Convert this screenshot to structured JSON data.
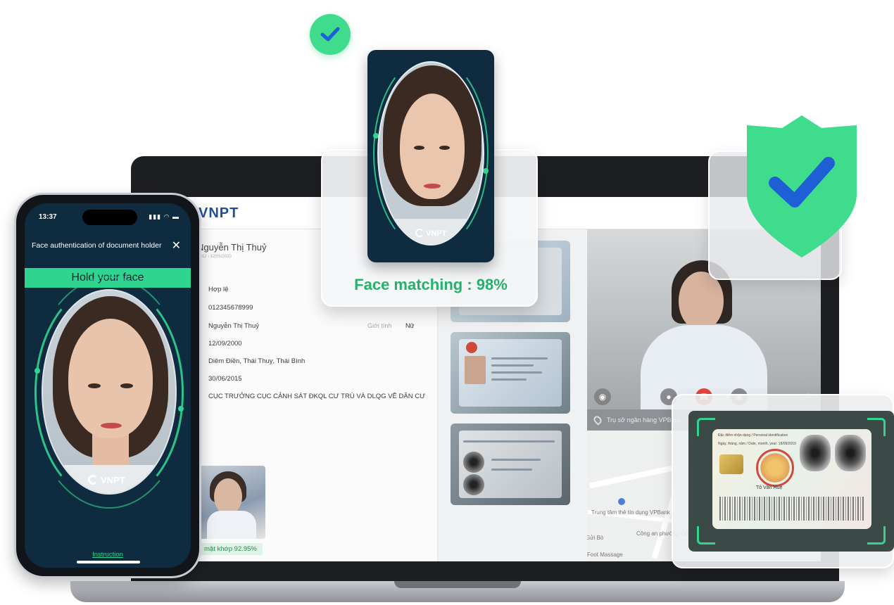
{
  "laptop": {
    "logo": "VNPT",
    "record": {
      "holder_name": "Nguyễn Thị Thuỷ",
      "holder_sub": "2012 - 12/05/2020",
      "rows": [
        "Hợp lệ",
        "012345678999",
        "Nguyễn Thị Thuỷ",
        "12/09/2000",
        "Diêm Điền, Thái Thuỵ, Thái Bình",
        "30/06/2015",
        "CỤC TRƯỞNG CỤC CẢNH SÁT ĐKQL CƯ TRÚ VÀ DLQG VỀ DÂN CƯ"
      ],
      "gender_label": "Giới tính",
      "gender_value": "Nữ",
      "match_pill": "mặt khớp 92.95%"
    },
    "map": {
      "address": "Trụ sở ngân hàng VPBank",
      "labels": [
        "Trung tâm thẻ tín dụng VPBank",
        "Công an phường Quốc Tử Giám",
        "Gửi Bò",
        "Foot Massage"
      ]
    },
    "video_controls": [
      "camera-icon",
      "microphone-icon",
      "end-call-icon",
      "video-icon",
      "fullscreen-icon"
    ]
  },
  "phone": {
    "time": "13:37",
    "status_icons": "▮▮▮ ◠ ▬",
    "title": "Face authentication of document holder",
    "close_glyph": "✕",
    "banner": "Hold your face",
    "brand": "VNPT",
    "instruction": "Instruction"
  },
  "match_card": {
    "brand": "VNPT",
    "label": "Face matching : 98%"
  },
  "id_card": {
    "header": "Đặc điểm nhận dạng / Personal identification",
    "date_line": "Ngày, tháng, năm / Date, month, year: 18/09/2019",
    "signer": "Tô Văn Huệ"
  },
  "colors": {
    "accent_green": "#2fd58f",
    "success_green": "#24b26b",
    "shield_green": "#3fdc8d",
    "check_blue": "#1e5fd6",
    "phone_bg": "#0f2b40"
  }
}
